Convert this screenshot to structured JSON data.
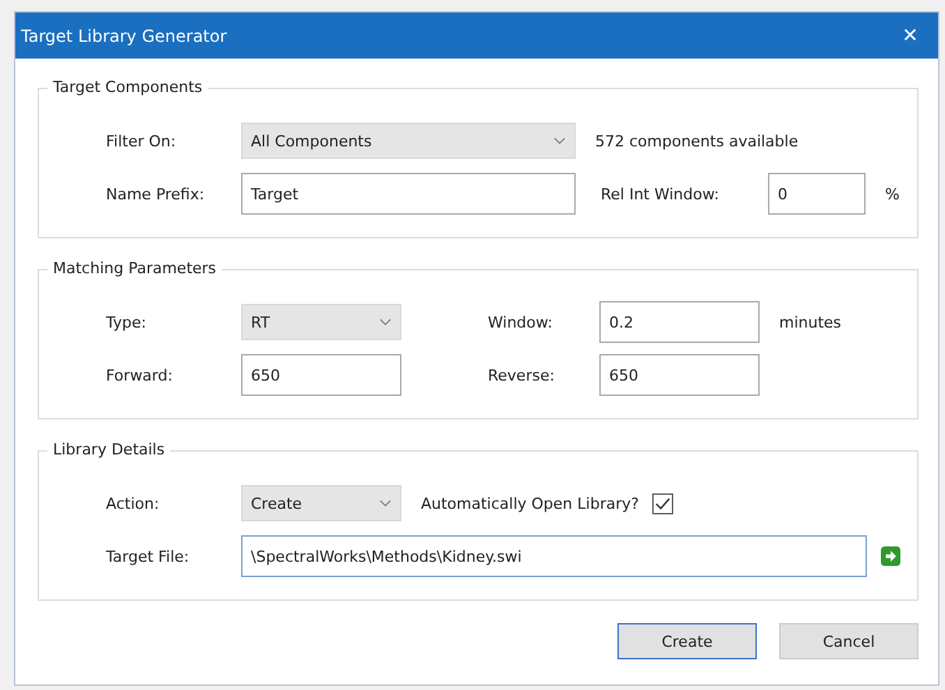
{
  "window": {
    "title": "Target Library Generator",
    "close": "✕"
  },
  "groups": [
    {
      "title": "Target Components",
      "rows": [
        [
          {
            "kind": "label",
            "text": "Filter On:"
          },
          {
            "kind": "select",
            "value": "All Components"
          },
          {
            "kind": "text",
            "text": "572 components available"
          }
        ],
        [
          {
            "kind": "label",
            "text": "Name Prefix:"
          },
          {
            "kind": "input",
            "value": "Target"
          },
          {
            "kind": "label2",
            "text": "Rel Int Window:"
          },
          {
            "kind": "input",
            "value": "0"
          },
          {
            "kind": "text",
            "text": "%"
          }
        ]
      ]
    },
    {
      "title": "Matching Parameters",
      "rows": [
        [
          {
            "kind": "label",
            "text": "Type:"
          },
          {
            "kind": "select",
            "value": "RT"
          },
          {
            "kind": "label3",
            "text": "Window:"
          },
          {
            "kind": "input",
            "value": "0.2"
          },
          {
            "kind": "text",
            "text": "minutes"
          }
        ],
        [
          {
            "kind": "label",
            "text": "Forward:"
          },
          {
            "kind": "input",
            "value": "650"
          },
          {
            "kind": "label3",
            "text": "Reverse:"
          },
          {
            "kind": "input",
            "value": "650"
          }
        ]
      ]
    },
    {
      "title": "Library Details",
      "rows": [
        [
          {
            "kind": "label",
            "text": "Action:"
          },
          {
            "kind": "select",
            "value": "Create"
          },
          {
            "kind": "text",
            "text": "Automatically Open Library?"
          },
          {
            "kind": "checkbox",
            "checked": true
          }
        ],
        [
          {
            "kind": "label",
            "text": "Target File:"
          },
          {
            "kind": "input",
            "value": "\\SpectralWorks\\Methods\\Kidney.swi",
            "focused": true
          },
          {
            "kind": "go"
          }
        ]
      ]
    }
  ],
  "buttons": [
    {
      "label": "Create",
      "default": true
    },
    {
      "label": "Cancel",
      "default": false
    }
  ]
}
